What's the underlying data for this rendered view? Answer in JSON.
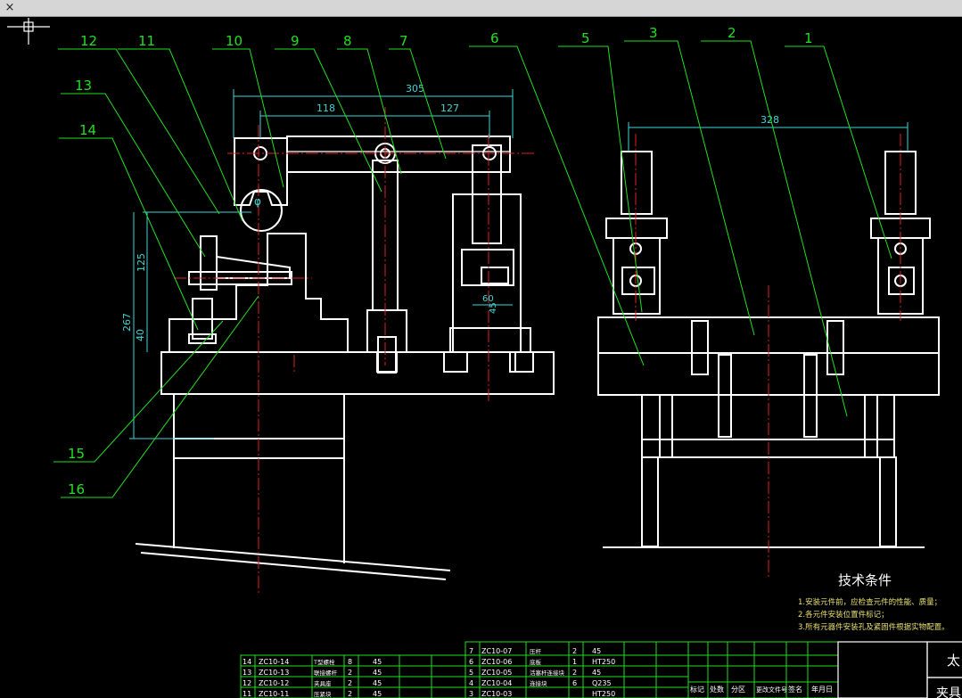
{
  "window": {
    "close_glyph": "×"
  },
  "colors": {
    "background": "#000000",
    "outline": "#ffffff",
    "leader": "#21e021",
    "dimension": "#3fd6d6",
    "centerline": "#e02020",
    "hatch": "#d63fd6",
    "table": "#21e021"
  },
  "balloons": [
    "12",
    "11",
    "10",
    "9",
    "8",
    "7",
    "6",
    "5",
    "3",
    "2",
    "1",
    "13",
    "14",
    "15",
    "16"
  ],
  "dimensions": {
    "d305": "305",
    "d118": "118",
    "d127": "127",
    "d328": "328",
    "d125": "125",
    "d267": "267",
    "d40": "40",
    "d60": "60",
    "d45": "45",
    "phi": "φ"
  },
  "tech": {
    "title": "技术条件",
    "lines": [
      "1.安装元件前，应检查元件的性能、质量；",
      "2.各元件安装位置件标记；",
      "3.所有元器件安装孔及紧固件根据实物配置。"
    ]
  },
  "bom_left": [
    {
      "no": "14",
      "code": "ZC10-14",
      "name": "T型螺栓",
      "qty": "8",
      "mat": "45"
    },
    {
      "no": "13",
      "code": "ZC10-13",
      "name": "联接螺杆",
      "qty": "2",
      "mat": "45"
    },
    {
      "no": "12",
      "code": "ZC10-12",
      "name": "夹具座",
      "qty": "2",
      "mat": "45"
    },
    {
      "no": "11",
      "code": "ZC10-11",
      "name": "压紧块",
      "qty": "2",
      "mat": "45"
    }
  ],
  "bom_right": [
    {
      "no": "7",
      "code": "ZC10-07",
      "name": "压杆",
      "qty": "2",
      "mat": "45"
    },
    {
      "no": "6",
      "code": "ZC10-06",
      "name": "底板",
      "qty": "1",
      "mat": "HT250"
    },
    {
      "no": "5",
      "code": "ZC10-05",
      "name": "活塞杆连接块",
      "qty": "2",
      "mat": "45"
    },
    {
      "no": "4",
      "code": "ZC10-04",
      "name": "连接块",
      "qty": "6",
      "mat": "Q235"
    },
    {
      "no": "3",
      "code": "ZC10-03",
      "name": "",
      "qty": "",
      "mat": "HT250"
    }
  ],
  "title_block": {
    "headers": [
      "标记",
      "处数",
      "分区",
      "更改文件号",
      "签名",
      "年月日"
    ],
    "company": "太",
    "drawing": "夹具"
  }
}
